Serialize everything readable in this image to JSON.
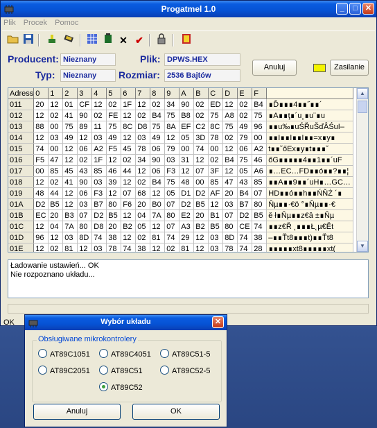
{
  "window": {
    "title": "Progatmel 1.0"
  },
  "menu": [
    "Plik",
    "Procek",
    "Pomoc"
  ],
  "info": {
    "producent_label": "Producent:",
    "producent_value": "Nieznany",
    "typ_label": "Typ:",
    "typ_value": "Nieznany",
    "plik_label": "Plik:",
    "plik_value": "DPWS.HEX",
    "rozmiar_label": "Rozmiar:",
    "rozmiar_value": "2536 Bajtów"
  },
  "buttons": {
    "anuluj": "Anuluj",
    "zasilanie": "Zasilanie"
  },
  "colors": {
    "power_indicator": "#f4f400"
  },
  "hex": {
    "header": [
      "Adress",
      "0",
      "1",
      "2",
      "3",
      "4",
      "5",
      "6",
      "7",
      "8",
      "9",
      "A",
      "B",
      "C",
      "D",
      "E",
      "F"
    ],
    "rows": [
      {
        "addr": "011",
        "bytes": [
          "20",
          "12",
          "01",
          "CF",
          "12",
          "02",
          "1F",
          "12",
          "02",
          "34",
          "90",
          "02",
          "ED",
          "12",
          "02",
          "B4"
        ],
        "ascii": " ∎Ď∎∎∎4∎∎˝∎∎´"
      },
      {
        "addr": "012",
        "bytes": [
          "12",
          "02",
          "41",
          "90",
          "02",
          "FE",
          "12",
          "02",
          "B4",
          "75",
          "B8",
          "02",
          "75",
          "A8",
          "02",
          "75"
        ],
        "ascii": "∎A∎∎ţ∎´u¸∎u¨∎u"
      },
      {
        "addr": "013",
        "bytes": [
          "88",
          "00",
          "75",
          "89",
          "11",
          "75",
          "8C",
          "D8",
          "75",
          "8A",
          "EF",
          "C2",
          "8C",
          "75",
          "49",
          "96"
        ],
        "ascii": "∎∎u‰∎uŚŘuŠďÂŚuI–"
      },
      {
        "addr": "014",
        "bytes": [
          "12",
          "03",
          "49",
          "12",
          "03",
          "49",
          "12",
          "03",
          "49",
          "12",
          "05",
          "3D",
          "78",
          "02",
          "79",
          "00"
        ],
        "ascii": "∎∎I∎∎I∎∎I∎∎=x∎y∎"
      },
      {
        "addr": "015",
        "bytes": [
          "74",
          "00",
          "12",
          "06",
          "A2",
          "F5",
          "45",
          "78",
          "06",
          "79",
          "00",
          "74",
          "00",
          "12",
          "06",
          "A2"
        ],
        "ascii": "t∎∎˘őEx∎y∎t∎∎∎˘"
      },
      {
        "addr": "016",
        "bytes": [
          "F5",
          "47",
          "12",
          "02",
          "1F",
          "12",
          "02",
          "34",
          "90",
          "03",
          "31",
          "12",
          "02",
          "B4",
          "75",
          "46"
        ],
        "ascii": "őG∎∎∎∎∎4∎∎1∎∎´uF"
      },
      {
        "addr": "017",
        "bytes": [
          "00",
          "85",
          "45",
          "43",
          "85",
          "46",
          "44",
          "12",
          "06",
          "F3",
          "12",
          "07",
          "3F",
          "12",
          "05",
          "A6"
        ],
        "ascii": "∎…EC…FD∎∎ó∎∎?∎∎¦"
      },
      {
        "addr": "018",
        "bytes": [
          "12",
          "02",
          "41",
          "90",
          "03",
          "39",
          "12",
          "02",
          "B4",
          "75",
          "48",
          "00",
          "85",
          "47",
          "43",
          "85"
        ],
        "ascii": "∎∎A∎∎9∎∎´uH∎…GC…"
      },
      {
        "addr": "019",
        "bytes": [
          "48",
          "44",
          "12",
          "06",
          "F3",
          "12",
          "07",
          "68",
          "12",
          "05",
          "D1",
          "D2",
          "AF",
          "20",
          "B4",
          "07"
        ],
        "ascii": "HD∎∎ó∎∎h∎∎ŃŇŻ ´∎"
      },
      {
        "addr": "01A",
        "bytes": [
          "D2",
          "B5",
          "12",
          "03",
          "B7",
          "80",
          "F6",
          "20",
          "B0",
          "07",
          "D2",
          "B5",
          "12",
          "03",
          "B7",
          "80"
        ],
        "ascii": "Ňµ∎∎·€ö °∎Ňµ∎∎·€"
      },
      {
        "addr": "01B",
        "bytes": [
          "EC",
          "20",
          "B3",
          "07",
          "D2",
          "B5",
          "12",
          "04",
          "7A",
          "80",
          "E2",
          "20",
          "B1",
          "07",
          "D2",
          "B5"
        ],
        "ascii": "ě ł∎Ňµ∎∎z€â ±∎Ňµ"
      },
      {
        "addr": "01C",
        "bytes": [
          "12",
          "04",
          "7A",
          "80",
          "D8",
          "20",
          "B2",
          "05",
          "12",
          "07",
          "A3",
          "B2",
          "B5",
          "80",
          "CE",
          "74"
        ],
        "ascii": "∎∎z€Ř ˛∎∎∎Ł˛µ€Ět"
      },
      {
        "addr": "01D",
        "bytes": [
          "96",
          "12",
          "03",
          "8D",
          "74",
          "38",
          "12",
          "02",
          "81",
          "74",
          "29",
          "12",
          "03",
          "8D",
          "74",
          "38"
        ],
        "ascii": "–∎∎Ťt8∎∎∎t)∎∎Ťt8"
      },
      {
        "addr": "01E",
        "bytes": [
          "12",
          "02",
          "81",
          "12",
          "03",
          "78",
          "74",
          "38",
          "12",
          "02",
          "81",
          "12",
          "03",
          "78",
          "74",
          "28"
        ],
        "ascii": "∎∎∎∎∎xt8∎∎∎∎∎xt("
      }
    ]
  },
  "log": [
    "Ładowanie ustawień... OK",
    "Nie rozpoznano układu..."
  ],
  "status": "OK",
  "dialog": {
    "title": "Wybór układu",
    "group_title": "Obsługiwane mikrokontrolery",
    "options": [
      "AT89C1051",
      "AT89C4051",
      "AT89C51-5",
      "AT89C2051",
      "AT89C51",
      "AT89C52-5",
      "AT89C52"
    ],
    "selected": "AT89C52",
    "cancel": "Anuluj",
    "ok": "OK"
  }
}
